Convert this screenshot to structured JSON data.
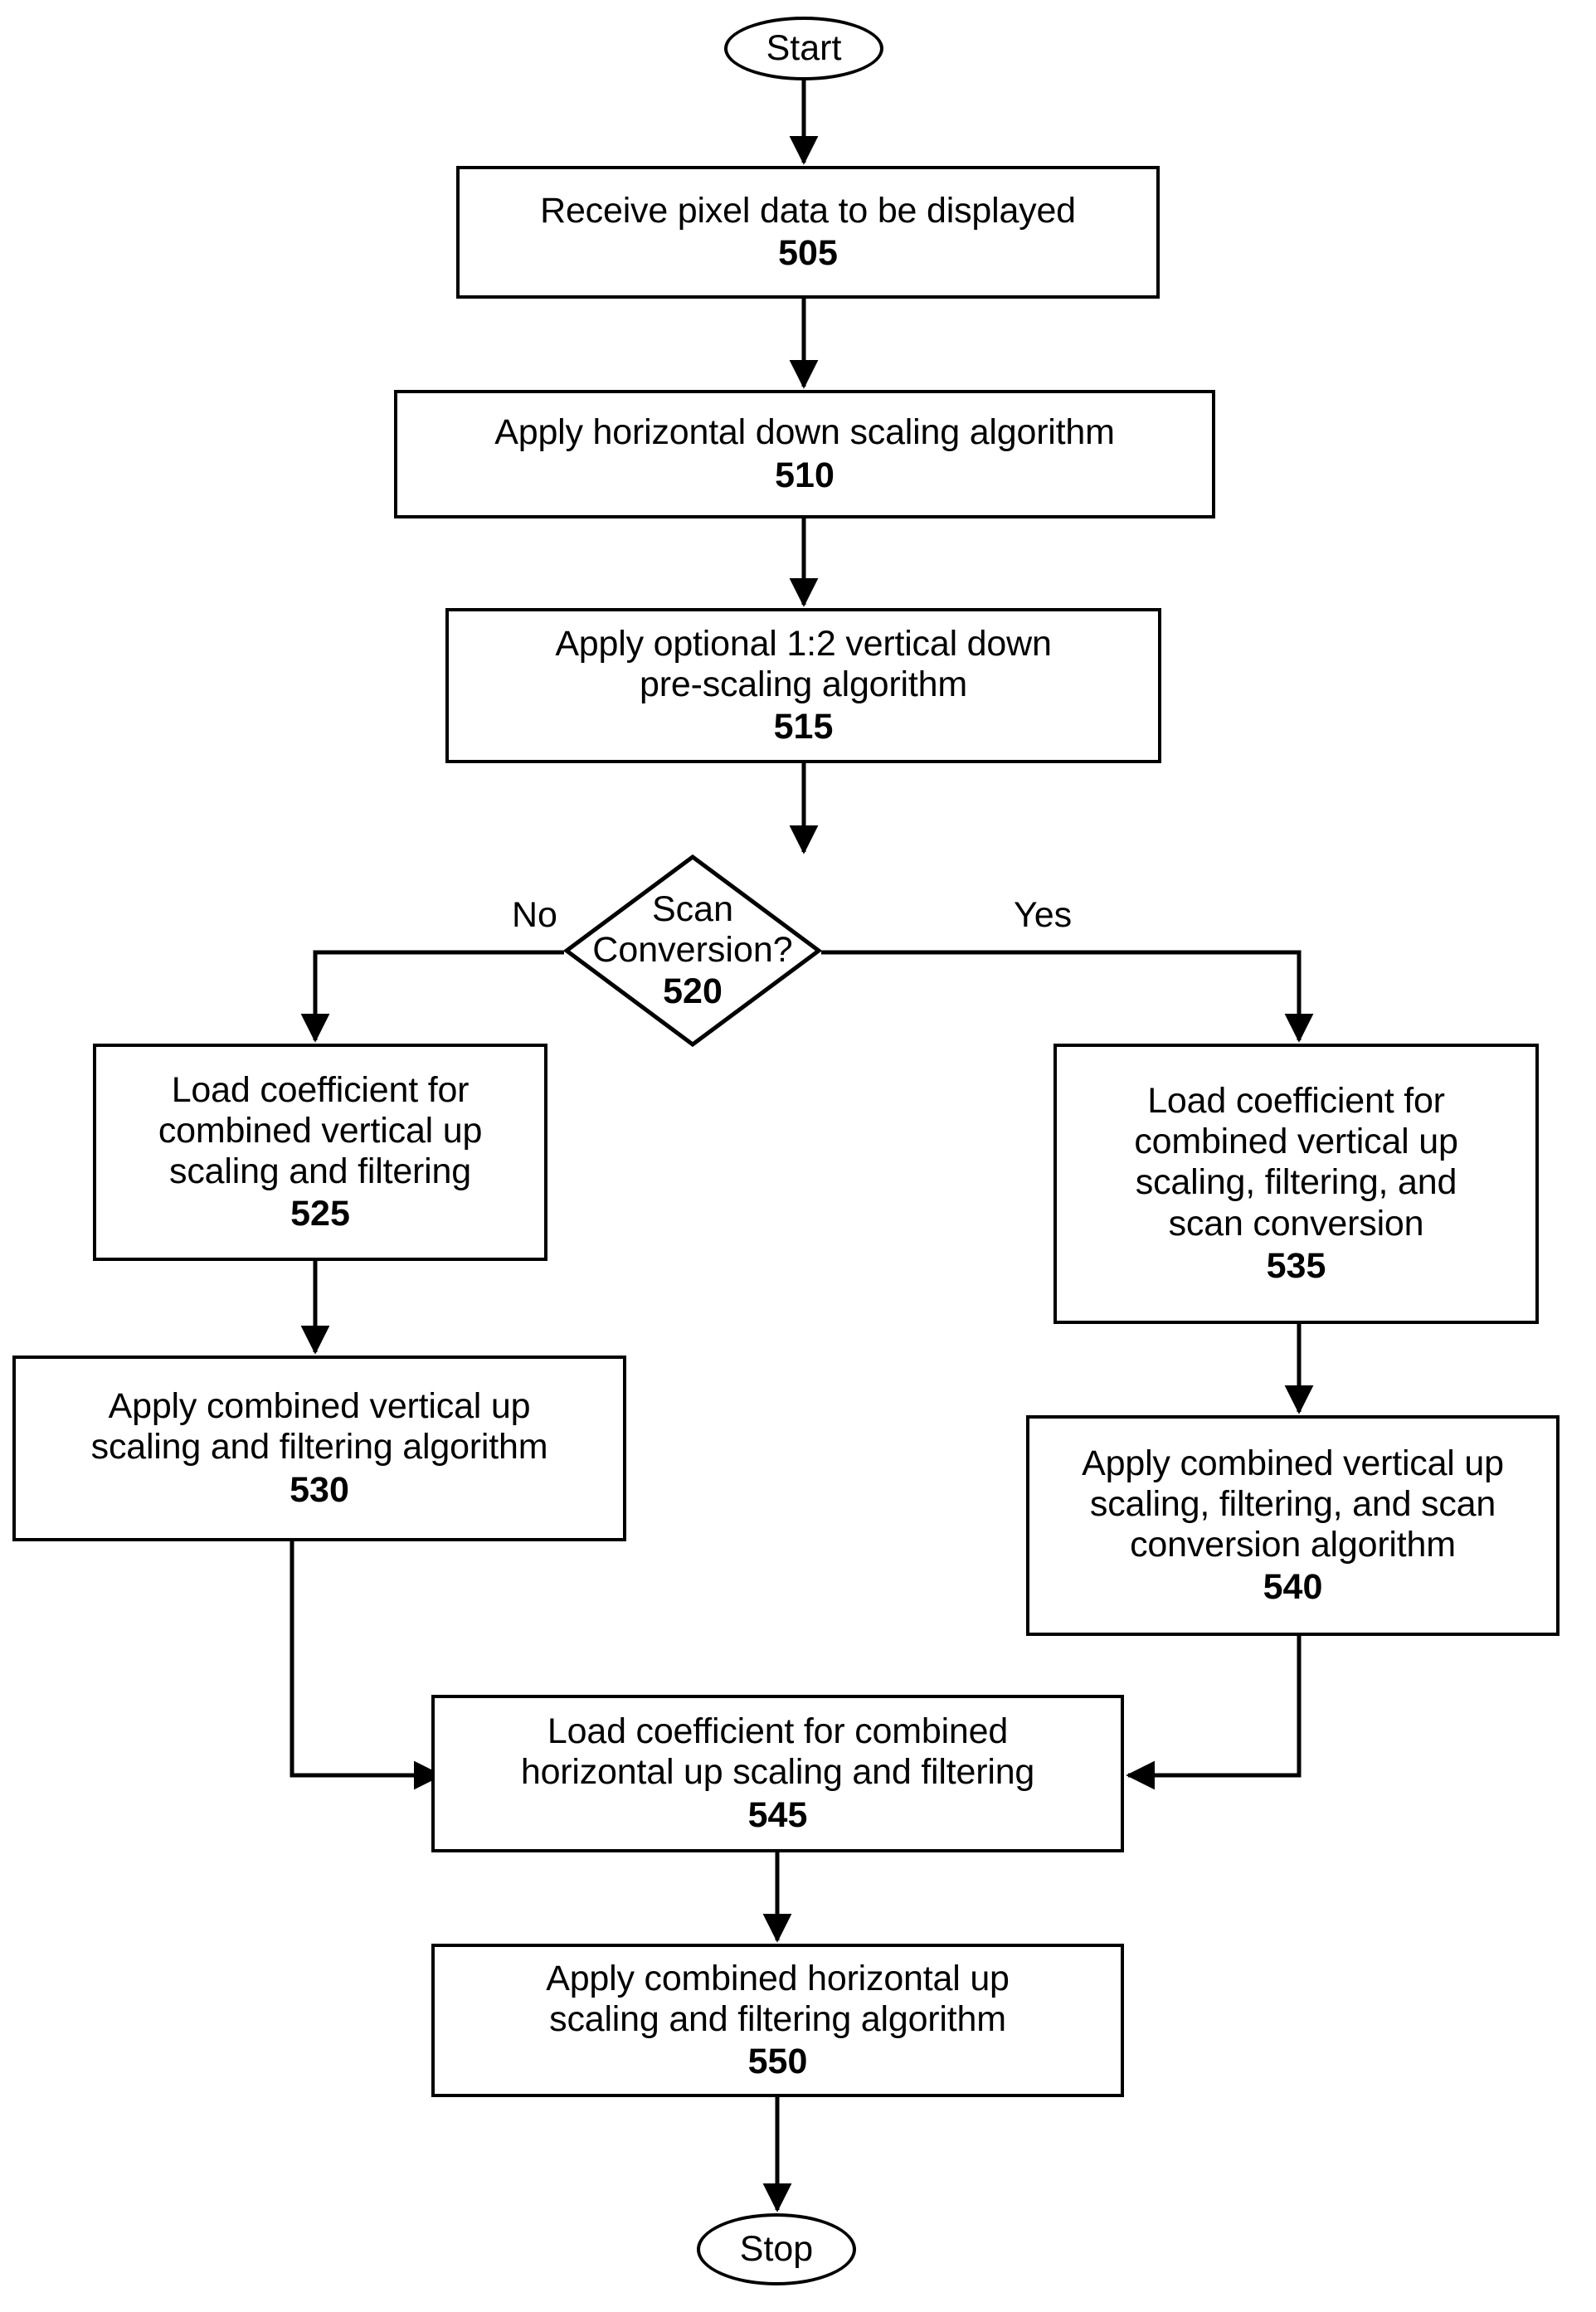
{
  "figure": {
    "type": "flowchart",
    "orientation": "top-to-bottom",
    "background_color": "#ffffff",
    "line_color": "#000000"
  },
  "nodes": {
    "start": {
      "label": "Start",
      "shape": "terminator"
    },
    "n505": {
      "text": "Receive pixel data to be displayed",
      "ref": "505",
      "shape": "process"
    },
    "n510": {
      "text": "Apply horizontal down scaling algorithm",
      "ref": "510",
      "shape": "process"
    },
    "n515": {
      "text": "Apply optional 1:2 vertical down\npre-scaling algorithm",
      "ref": "515",
      "shape": "process"
    },
    "n520": {
      "text": "Scan\nConversion?",
      "ref": "520",
      "shape": "decision"
    },
    "n525": {
      "text": "Load coefficient for\ncombined vertical up\nscaling and filtering",
      "ref": "525",
      "shape": "process"
    },
    "n530": {
      "text": "Apply combined vertical up\nscaling and filtering algorithm",
      "ref": "530",
      "shape": "process"
    },
    "n535": {
      "text": "Load coefficient for\ncombined vertical up\nscaling, filtering, and\nscan conversion",
      "ref": "535",
      "shape": "process"
    },
    "n540": {
      "text": "Apply combined vertical up\nscaling, filtering, and scan\nconversion algorithm",
      "ref": "540",
      "shape": "process"
    },
    "n545": {
      "text": "Load coefficient for combined\nhorizontal up scaling and filtering",
      "ref": "545",
      "shape": "process"
    },
    "n550": {
      "text": "Apply combined horizontal up\nscaling and filtering algorithm",
      "ref": "550",
      "shape": "process"
    },
    "stop": {
      "label": "Stop",
      "shape": "terminator"
    }
  },
  "branch_labels": {
    "no": "No",
    "yes": "Yes"
  },
  "edges": [
    {
      "from": "start",
      "to": "n505",
      "label": ""
    },
    {
      "from": "n505",
      "to": "n510",
      "label": ""
    },
    {
      "from": "n510",
      "to": "n515",
      "label": ""
    },
    {
      "from": "n515",
      "to": "n520",
      "label": ""
    },
    {
      "from": "n520",
      "to": "n525",
      "label": "No"
    },
    {
      "from": "n520",
      "to": "n535",
      "label": "Yes"
    },
    {
      "from": "n525",
      "to": "n530",
      "label": ""
    },
    {
      "from": "n530",
      "to": "n545",
      "label": ""
    },
    {
      "from": "n535",
      "to": "n540",
      "label": ""
    },
    {
      "from": "n540",
      "to": "n545",
      "label": ""
    },
    {
      "from": "n545",
      "to": "n550",
      "label": ""
    },
    {
      "from": "n550",
      "to": "stop",
      "label": ""
    }
  ]
}
